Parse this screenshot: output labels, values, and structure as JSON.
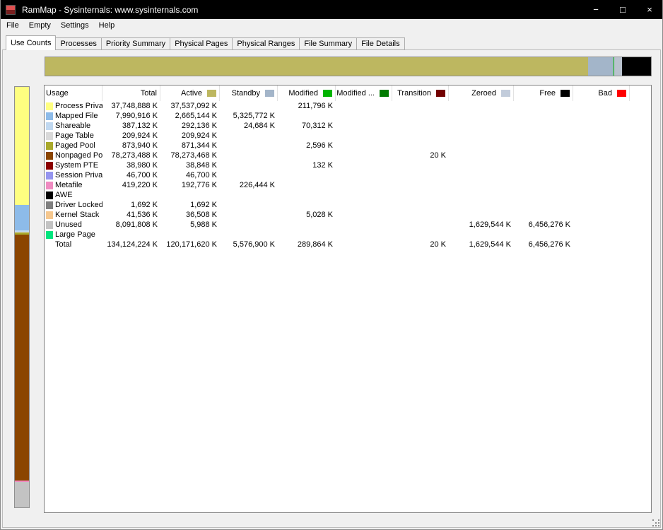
{
  "window": {
    "title": "RamMap - Sysinternals: www.sysinternals.com",
    "controls": [
      {
        "name": "minimize",
        "glyph": "−"
      },
      {
        "name": "maximize",
        "glyph": "□"
      },
      {
        "name": "close",
        "glyph": "×"
      }
    ]
  },
  "menu": [
    "File",
    "Empty",
    "Settings",
    "Help"
  ],
  "tabs": [
    {
      "label": "Use Counts",
      "active": true
    },
    {
      "label": "Processes",
      "active": false
    },
    {
      "label": "Priority Summary",
      "active": false
    },
    {
      "label": "Physical Pages",
      "active": false
    },
    {
      "label": "Physical Ranges",
      "active": false
    },
    {
      "label": "File Summary",
      "active": false
    },
    {
      "label": "File Details",
      "active": false
    }
  ],
  "memory_bar_horizontal": {
    "segments": [
      {
        "name": "active",
        "color": "#BDB760",
        "fraction": 0.896
      },
      {
        "name": "standby",
        "color": "#A3B5C9",
        "fraction": 0.0416
      },
      {
        "name": "modified",
        "color": "#00B400",
        "fraction": 0.0022
      },
      {
        "name": "zeroed",
        "color": "#B9C2CE",
        "fraction": 0.0121
      },
      {
        "name": "free",
        "color": "#000000",
        "fraction": 0.0481
      }
    ]
  },
  "memory_bar_vertical": {
    "segments": [
      {
        "name": "process-private",
        "color": "#FFFF80",
        "fraction": 0.2815
      },
      {
        "name": "mapped-file",
        "color": "#8DBBE9",
        "fraction": 0.0596
      },
      {
        "name": "shareable",
        "color": "#C0D8F0",
        "fraction": 0.0029
      },
      {
        "name": "page-table",
        "color": "#D9D9D9",
        "fraction": 0.0016
      },
      {
        "name": "paged-pool",
        "color": "#A9A92B",
        "fraction": 0.0065
      },
      {
        "name": "nonpaged-pool",
        "color": "#8B4500",
        "fraction": 0.5836
      },
      {
        "name": "system-pte",
        "color": "#8B0000",
        "fraction": 0.0003
      },
      {
        "name": "session-private",
        "color": "#9595EF",
        "fraction": 0.0003
      },
      {
        "name": "metafile",
        "color": "#EF8BC1",
        "fraction": 0.0031
      },
      {
        "name": "driver-locked",
        "color": "#7F7F7F",
        "fraction": 0.0
      },
      {
        "name": "kernel-stack",
        "color": "#F5C78E",
        "fraction": 0.0003
      },
      {
        "name": "unused",
        "color": "#C3C3C3",
        "fraction": 0.0603
      }
    ]
  },
  "table": {
    "columns": [
      {
        "label": "Usage",
        "swatch": null
      },
      {
        "label": "Total",
        "swatch": null
      },
      {
        "label": "Active",
        "swatch": "#BDB760"
      },
      {
        "label": "Standby",
        "swatch": "#A3B5C9"
      },
      {
        "label": "Modified",
        "swatch": "#00B400"
      },
      {
        "label": "Modified ...",
        "swatch": "#007A00"
      },
      {
        "label": "Transition",
        "swatch": "#720000"
      },
      {
        "label": "Zeroed",
        "swatch": "#C2CCDB"
      },
      {
        "label": "Free",
        "swatch": "#000000"
      },
      {
        "label": "Bad",
        "swatch": "#FF0000"
      }
    ],
    "rows": [
      {
        "usage": "Process Private",
        "color": "#FFFF80",
        "values": [
          "37,748,888 K",
          "37,537,092 K",
          "",
          "211,796 K",
          "",
          "",
          "",
          "",
          ""
        ]
      },
      {
        "usage": "Mapped File",
        "color": "#8DBBE9",
        "values": [
          "7,990,916 K",
          "2,665,144 K",
          "5,325,772 K",
          "",
          "",
          "",
          "",
          "",
          ""
        ]
      },
      {
        "usage": "Shareable",
        "color": "#C0D8F0",
        "values": [
          "387,132 K",
          "292,136 K",
          "24,684 K",
          "70,312 K",
          "",
          "",
          "",
          "",
          ""
        ]
      },
      {
        "usage": "Page Table",
        "color": "#D9D9D9",
        "values": [
          "209,924 K",
          "209,924 K",
          "",
          "",
          "",
          "",
          "",
          "",
          ""
        ]
      },
      {
        "usage": "Paged Pool",
        "color": "#A9A92B",
        "values": [
          "873,940 K",
          "871,344 K",
          "",
          "2,596 K",
          "",
          "",
          "",
          "",
          ""
        ]
      },
      {
        "usage": "Nonpaged Pool",
        "color": "#8B4500",
        "values": [
          "78,273,488 K",
          "78,273,468 K",
          "",
          "",
          "",
          "20 K",
          "",
          "",
          ""
        ]
      },
      {
        "usage": "System PTE",
        "color": "#8B0000",
        "values": [
          "38,980 K",
          "38,848 K",
          "",
          "132 K",
          "",
          "",
          "",
          "",
          ""
        ]
      },
      {
        "usage": "Session Private",
        "color": "#9595EF",
        "values": [
          "46,700 K",
          "46,700 K",
          "",
          "",
          "",
          "",
          "",
          "",
          ""
        ]
      },
      {
        "usage": "Metafile",
        "color": "#EF8BC1",
        "values": [
          "419,220 K",
          "192,776 K",
          "226,444 K",
          "",
          "",
          "",
          "",
          "",
          ""
        ]
      },
      {
        "usage": "AWE",
        "color": "#000000",
        "values": [
          "",
          "",
          "",
          "",
          "",
          "",
          "",
          "",
          ""
        ]
      },
      {
        "usage": "Driver Locked",
        "color": "#7F7F7F",
        "values": [
          "1,692 K",
          "1,692 K",
          "",
          "",
          "",
          "",
          "",
          "",
          ""
        ]
      },
      {
        "usage": "Kernel Stack",
        "color": "#F5C78E",
        "values": [
          "41,536 K",
          "36,508 K",
          "",
          "5,028 K",
          "",
          "",
          "",
          "",
          ""
        ]
      },
      {
        "usage": "Unused",
        "color": "#C3C3C3",
        "values": [
          "8,091,808 K",
          "5,988 K",
          "",
          "",
          "",
          "",
          "1,629,544 K",
          "6,456,276 K",
          ""
        ]
      },
      {
        "usage": "Large Page",
        "color": "#00E57E",
        "values": [
          "",
          "",
          "",
          "",
          "",
          "",
          "",
          "",
          ""
        ]
      },
      {
        "usage": "Total",
        "color": null,
        "values": [
          "134,124,224 K",
          "120,171,620 K",
          "5,576,900 K",
          "289,864 K",
          "",
          "20 K",
          "1,629,544 K",
          "6,456,276 K",
          ""
        ]
      }
    ]
  }
}
